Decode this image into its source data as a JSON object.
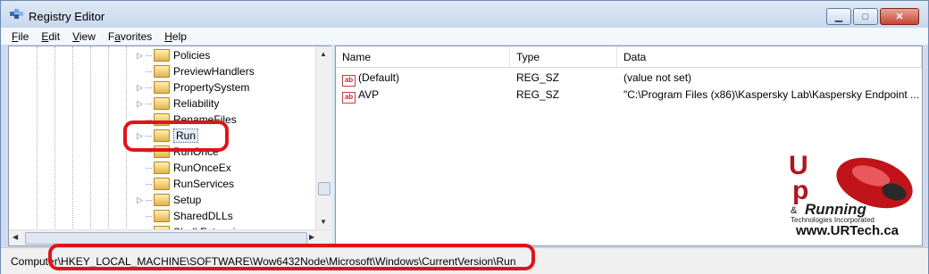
{
  "window": {
    "title": "Registry Editor"
  },
  "menu": [
    {
      "key": "F",
      "rest": "ile"
    },
    {
      "key": "E",
      "rest": "dit"
    },
    {
      "key": "V",
      "rest": "iew"
    },
    {
      "prefix": "F",
      "key": "a",
      "rest": "vorites"
    },
    {
      "key": "H",
      "rest": "elp"
    }
  ],
  "tree": {
    "items": [
      {
        "label": "Policies",
        "expandable": true
      },
      {
        "label": "PreviewHandlers",
        "expandable": false
      },
      {
        "label": "PropertySystem",
        "expandable": true
      },
      {
        "label": "Reliability",
        "expandable": true
      },
      {
        "label": "RenameFiles",
        "expandable": false
      },
      {
        "label": "Run",
        "expandable": true,
        "selected": true
      },
      {
        "label": "RunOnce",
        "expandable": false
      },
      {
        "label": "RunOnceEx",
        "expandable": false
      },
      {
        "label": "RunServices",
        "expandable": false
      },
      {
        "label": "Setup",
        "expandable": true
      },
      {
        "label": "SharedDLLs",
        "expandable": false
      },
      {
        "label": "Shell Extensions",
        "expandable": true
      }
    ]
  },
  "list": {
    "columns": [
      "Name",
      "Type",
      "Data"
    ],
    "rows": [
      {
        "name": "(Default)",
        "type": "REG_SZ",
        "data": "(value not set)"
      },
      {
        "name": "AVP",
        "type": "REG_SZ",
        "data": "\"C:\\Program Files (x86)\\Kaspersky Lab\\Kaspersky Endpoint ..."
      }
    ]
  },
  "status": {
    "path": "Computer\\HKEY_LOCAL_MACHINE\\SOFTWARE\\Wow6432Node\\Microsoft\\Windows\\CurrentVersion\\Run"
  },
  "watermark": {
    "brand": "Running",
    "tagline": "Technologies Incorporated",
    "url": "www.URTech.ca"
  },
  "colors": {
    "highlight": "#e0141b",
    "titlebar": "#c7d7ec",
    "close_button": "#c64630"
  },
  "icons": [
    "registry-editor-icon",
    "folder-icon",
    "string-value-icon",
    "minimize-icon",
    "maximize-icon",
    "close-icon"
  ]
}
